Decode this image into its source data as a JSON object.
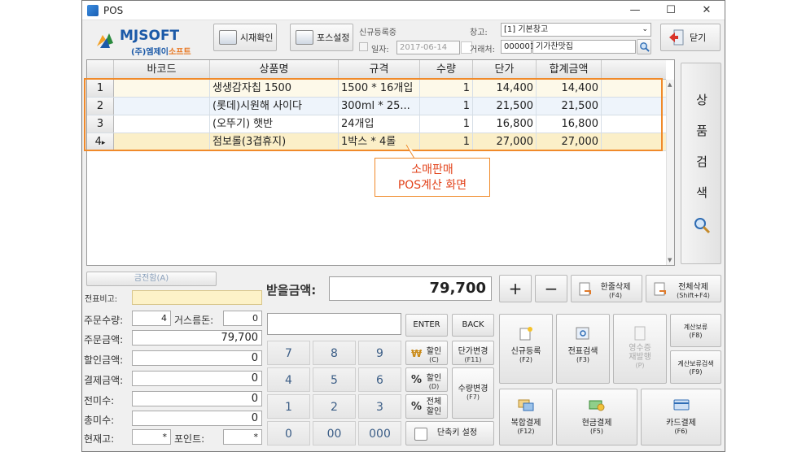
{
  "window": {
    "title": "POS"
  },
  "logo": {
    "brand": "MJSOFT",
    "sub_prefix": "(주)엠제이",
    "sub_suffix": "소프트"
  },
  "toolbar": {
    "time_check": "시재확인",
    "pos_settings": "포스설정",
    "close": "닫기"
  },
  "filters": {
    "new_registration_label": "신규등록중",
    "date_label": "일자:",
    "date_value": "2017-06-14",
    "warehouse_label": "창고:",
    "warehouse_value": "[1] 기본창고",
    "customer_label": "거래처:",
    "customer_code": "000001",
    "customer_name": "기가찬맛집"
  },
  "grid": {
    "headers": [
      "바코드",
      "상품명",
      "규격",
      "수량",
      "단가",
      "합계금액"
    ],
    "rows": [
      {
        "idx": "1",
        "barcode": "",
        "name": "생생감자칩 1500",
        "spec": "1500 * 16개입",
        "qty": "1",
        "price": "14,400",
        "total": "14,400"
      },
      {
        "idx": "2",
        "barcode": "",
        "name": "(롯데)시원해 사이다",
        "spec": "300ml * 25...",
        "qty": "1",
        "price": "21,500",
        "total": "21,500"
      },
      {
        "idx": "3",
        "barcode": "",
        "name": "(오뚜기) 햇반",
        "spec": "24개입",
        "qty": "1",
        "price": "16,800",
        "total": "16,800"
      },
      {
        "idx": "4",
        "barcode": "",
        "name": "점보롤(3겹휴지)",
        "spec": "1박스 * 4롤",
        "qty": "1",
        "price": "27,000",
        "total": "27,000"
      }
    ],
    "row_colors": [
      "#fdf9e9",
      "#eef4fb",
      "#ffffff",
      "#fbefc8"
    ]
  },
  "callout": {
    "line1": "소매판매",
    "line2": "POS계산 화면"
  },
  "side_search": {
    "chars": [
      "상",
      "품",
      "검",
      "색"
    ]
  },
  "left_panel": {
    "cash_drawer": "금전함(A)",
    "memo_label": "전표비고:",
    "order_qty_label": "주문수량:",
    "order_qty": "4",
    "change_label": "거스름돈:",
    "change": "0",
    "order_amount_label": "주문금액:",
    "order_amount": "79,700",
    "discount_label": "할인금액:",
    "discount": "0",
    "payment_label": "결제금액:",
    "payment": "0",
    "prev_unpaid_label": "전미수:",
    "prev_unpaid": "0",
    "total_unpaid_label": "총미수:",
    "total_unpaid": "0",
    "stock_label": "현재고:",
    "stock": "*",
    "point_label": "포인트:",
    "point": "*"
  },
  "receive": {
    "label": "받을금액:",
    "amount": "79,700"
  },
  "qty_buttons": {
    "plus": "+",
    "minus": "−"
  },
  "delete_buttons": {
    "line_delete": "한줄삭제",
    "line_delete_key": "(F4)",
    "all_delete": "전체삭제",
    "all_delete_key": "(Shift+F4)"
  },
  "keypad": {
    "enter": "ENTER",
    "back": "BACK",
    "keys": [
      "7",
      "8",
      "9",
      "4",
      "5",
      "6",
      "1",
      "2",
      "3",
      "0",
      "00",
      "000"
    ]
  },
  "mid_buttons": {
    "discount": "할인",
    "discount_key": "(C)",
    "unit_change": "단가변경",
    "unit_change_key": "(F11)",
    "discount_d": "할인",
    "discount_d_key": "(D)",
    "qty_change": "수량변경",
    "qty_change_key": "(F7)",
    "all_discount": "전체",
    "all_discount2": "할인",
    "shortcut": "단축키 설정"
  },
  "action_buttons": {
    "new_reg": "신규등록",
    "new_reg_key": "(F2)",
    "slip_search": "전표검색",
    "slip_search_key": "(F3)",
    "receipt": "영수증",
    "receipt2": "재발행",
    "receipt_key": "(P)",
    "hold": "계산보류",
    "hold_key": "(F8)",
    "hold_search": "계산보류검색",
    "hold_search_key": "(F9)",
    "mixed_pay": "복합결제",
    "mixed_pay_key": "(F12)",
    "cash_pay": "현금결제",
    "cash_pay_key": "(F5)",
    "card_pay": "카드결제",
    "card_pay_key": "(F6)"
  }
}
